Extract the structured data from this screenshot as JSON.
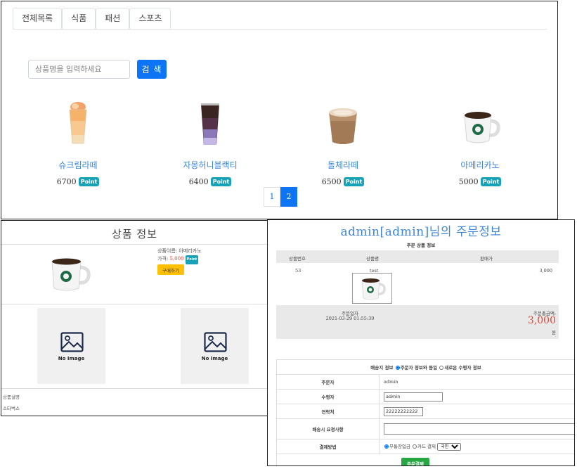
{
  "shop": {
    "tabs": [
      "전체목록",
      "식품",
      "패션",
      "스포츠"
    ],
    "search": {
      "placeholder": "상품명을 입력하세요",
      "button": "검 색"
    },
    "products": [
      {
        "name": "슈크림라떼",
        "price": "6700",
        "badge": "Point",
        "icon": "iced-latte-drink-image"
      },
      {
        "name": "자몽허니블랙티",
        "price": "6400",
        "badge": "Point",
        "icon": "iced-tea-drink-image"
      },
      {
        "name": "돌체라떼",
        "price": "6500",
        "badge": "Point",
        "icon": "latte-cup-image"
      },
      {
        "name": "아메리카노",
        "price": "5000",
        "badge": "Point",
        "icon": "coffee-mug-image"
      }
    ],
    "pages": [
      "1",
      "2"
    ],
    "active_page": "2",
    "accent": "#0d74f5",
    "badge_color": "#17a2b8"
  },
  "detail": {
    "title": "상품 정보",
    "name_line": "상품이름: 아메리카노",
    "price_label": "가격:",
    "price": "5,000",
    "badge": "Point",
    "buy_button": "구매하기",
    "no_image": "No Image",
    "desc_label": "상품설명",
    "desc_text": "스타벅스"
  },
  "order": {
    "title": "admin[admin]님의 주문정보",
    "subtitle": "주문 상품 정보",
    "headers": [
      "상품번호",
      "상품명",
      "판매가"
    ],
    "item": {
      "no": "53",
      "name": "test",
      "price": "3,000"
    },
    "date_label": "주문일자",
    "date": "2021-03-29 01:55:39",
    "total_label": "주문총금액:",
    "total": "3,000",
    "total_unit": "원",
    "ship_header": "배송지 정보",
    "ship_opt1": "주문자 정보와 동일",
    "ship_opt2": "새로운 수령자 정보",
    "orderer_label": "주문자",
    "orderer": "admin",
    "receiver_label": "수령자",
    "receiver": "admin",
    "phone_label": "연락처",
    "phone": "22222222222",
    "request_label": "배송시 요청사항",
    "pay_label": "결제방법",
    "pay_opt1": "무통장입금",
    "pay_opt2": "카드 결제",
    "card_select": "국민",
    "pay_button": "주문결제",
    "total_color": "#d54a3a"
  }
}
